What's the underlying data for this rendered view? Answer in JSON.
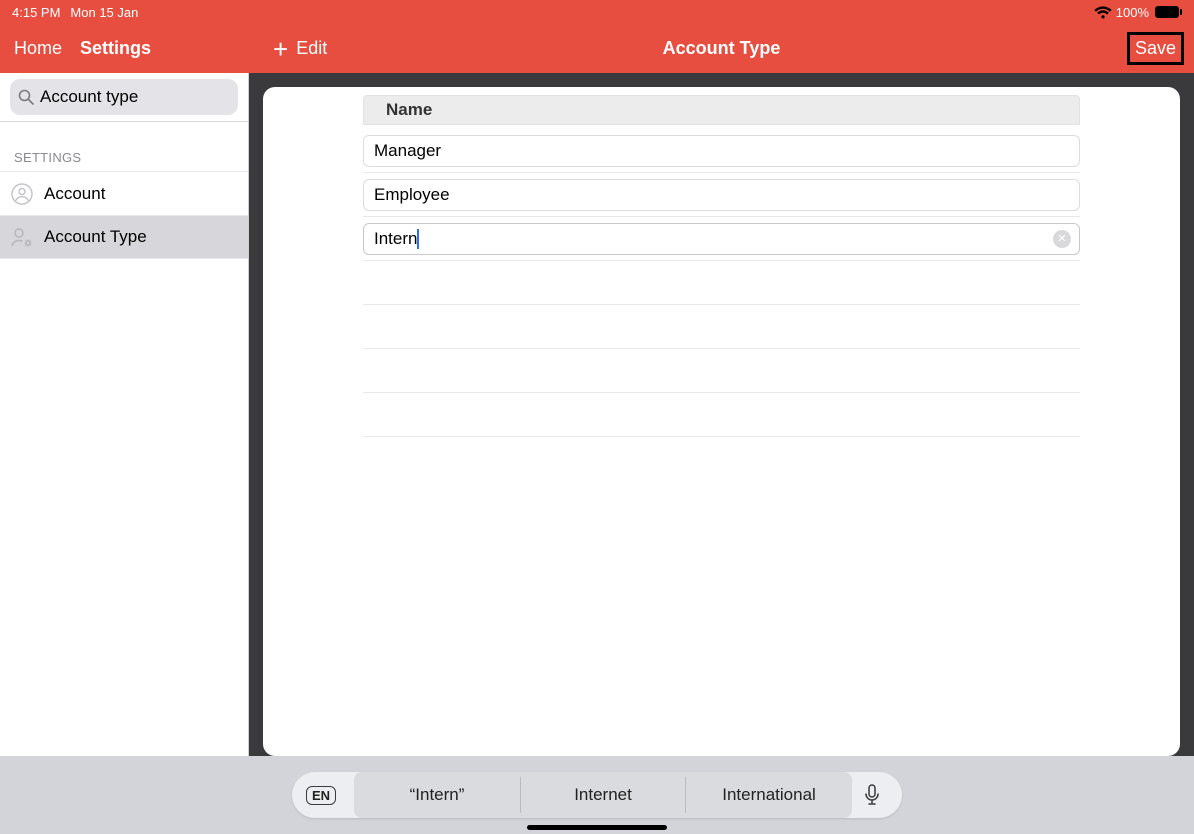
{
  "status": {
    "time": "4:15 PM",
    "date": "Mon 15 Jan",
    "battery": "100%"
  },
  "nav": {
    "home": "Home",
    "settings": "Settings",
    "edit": "Edit",
    "title": "Account Type",
    "save": "Save"
  },
  "search": {
    "value": "Account type"
  },
  "sidebar": {
    "section": "SETTINGS",
    "items": [
      {
        "label": "Account"
      },
      {
        "label": "Account Type"
      }
    ]
  },
  "table": {
    "header": "Name",
    "rows": [
      {
        "value": "Manager"
      },
      {
        "value": "Employee"
      },
      {
        "value": "Intern",
        "editing": true
      }
    ]
  },
  "keyboard": {
    "lang": "EN",
    "suggestions": [
      "“Intern”",
      "Internet",
      "International"
    ]
  }
}
